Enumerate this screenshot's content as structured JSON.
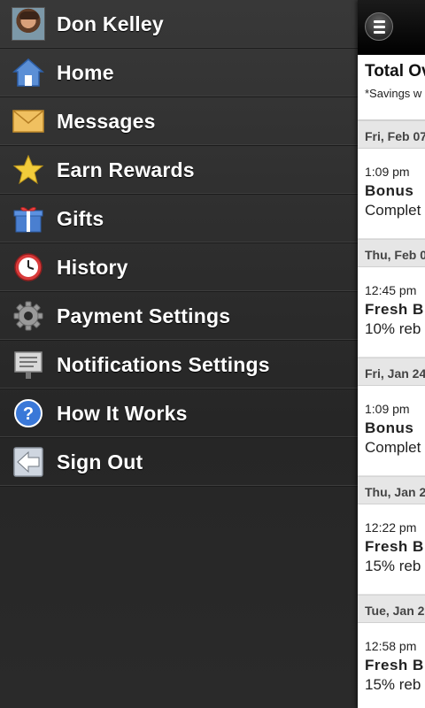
{
  "drawer": {
    "profile": {
      "name": "Don Kelley"
    },
    "items": [
      {
        "label": "Home",
        "icon": "home-icon"
      },
      {
        "label": "Messages",
        "icon": "envelope-icon"
      },
      {
        "label": "Earn Rewards",
        "icon": "star-icon"
      },
      {
        "label": "Gifts",
        "icon": "gift-icon"
      },
      {
        "label": "History",
        "icon": "clock-icon"
      },
      {
        "label": "Payment Settings",
        "icon": "gear-icon"
      },
      {
        "label": "Notifications Settings",
        "icon": "notification-board-icon"
      },
      {
        "label": "How It Works",
        "icon": "help-icon"
      },
      {
        "label": "Sign Out",
        "icon": "sign-out-arrow-icon"
      }
    ]
  },
  "panel": {
    "total_title": "Total Ov",
    "total_note": "*Savings w",
    "groups": [
      {
        "date": "Fri, Feb 07",
        "time": "1:09 pm",
        "title": "Bonus",
        "desc": "Complet"
      },
      {
        "date": "Thu, Feb 0",
        "time": "12:45 pm",
        "title": "Fresh B",
        "desc": "10% reb"
      },
      {
        "date": "Fri, Jan 24",
        "time": "1:09 pm",
        "title": "Bonus",
        "desc": "Complet"
      },
      {
        "date": "Thu, Jan 2",
        "time": "12:22 pm",
        "title": "Fresh B",
        "desc": "15% reb"
      },
      {
        "date": "Tue, Jan 2",
        "time": "12:58 pm",
        "title": "Fresh B",
        "desc": "15% reb"
      }
    ]
  }
}
